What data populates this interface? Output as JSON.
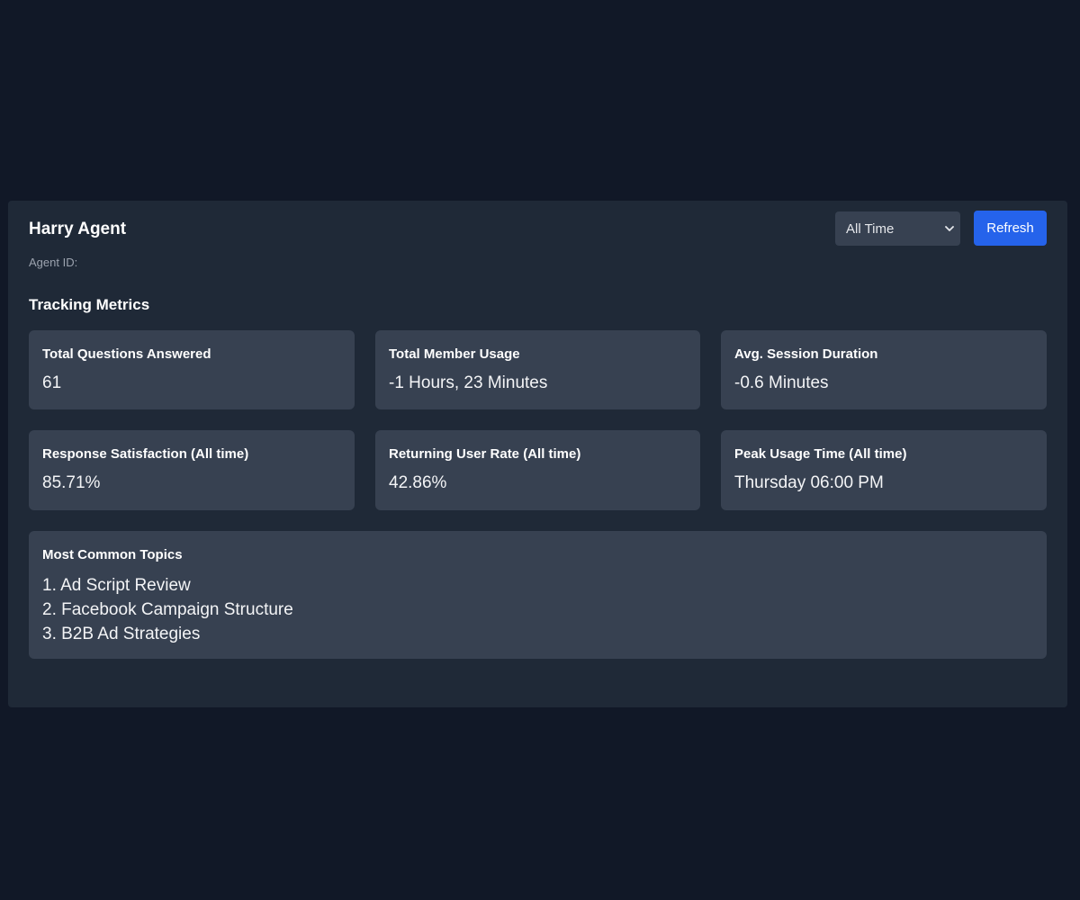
{
  "agent": {
    "name": "Harry Agent",
    "id_label": "Agent ID:"
  },
  "controls": {
    "time_range_selected": "All Time",
    "refresh_label": "Refresh"
  },
  "section": {
    "title": "Tracking Metrics"
  },
  "metrics": [
    {
      "label": "Total Questions Answered",
      "value": "61"
    },
    {
      "label": "Total Member Usage",
      "value": "-1 Hours, 23 Minutes"
    },
    {
      "label": "Avg. Session Duration",
      "value": "-0.6 Minutes"
    },
    {
      "label": "Response Satisfaction (All time)",
      "value": "85.71%"
    },
    {
      "label": "Returning User Rate (All time)",
      "value": "42.86%"
    },
    {
      "label": "Peak Usage Time (All time)",
      "value": "Thursday 06:00 PM"
    }
  ],
  "topics": {
    "label": "Most Common Topics",
    "items": [
      "1. Ad Script Review",
      "2. Facebook Campaign Structure",
      "3. B2B Ad Strategies"
    ]
  },
  "colors": {
    "page_background": "#111827",
    "panel_background": "#1f2937",
    "card_background": "#374151",
    "accent": "#2563eb"
  }
}
